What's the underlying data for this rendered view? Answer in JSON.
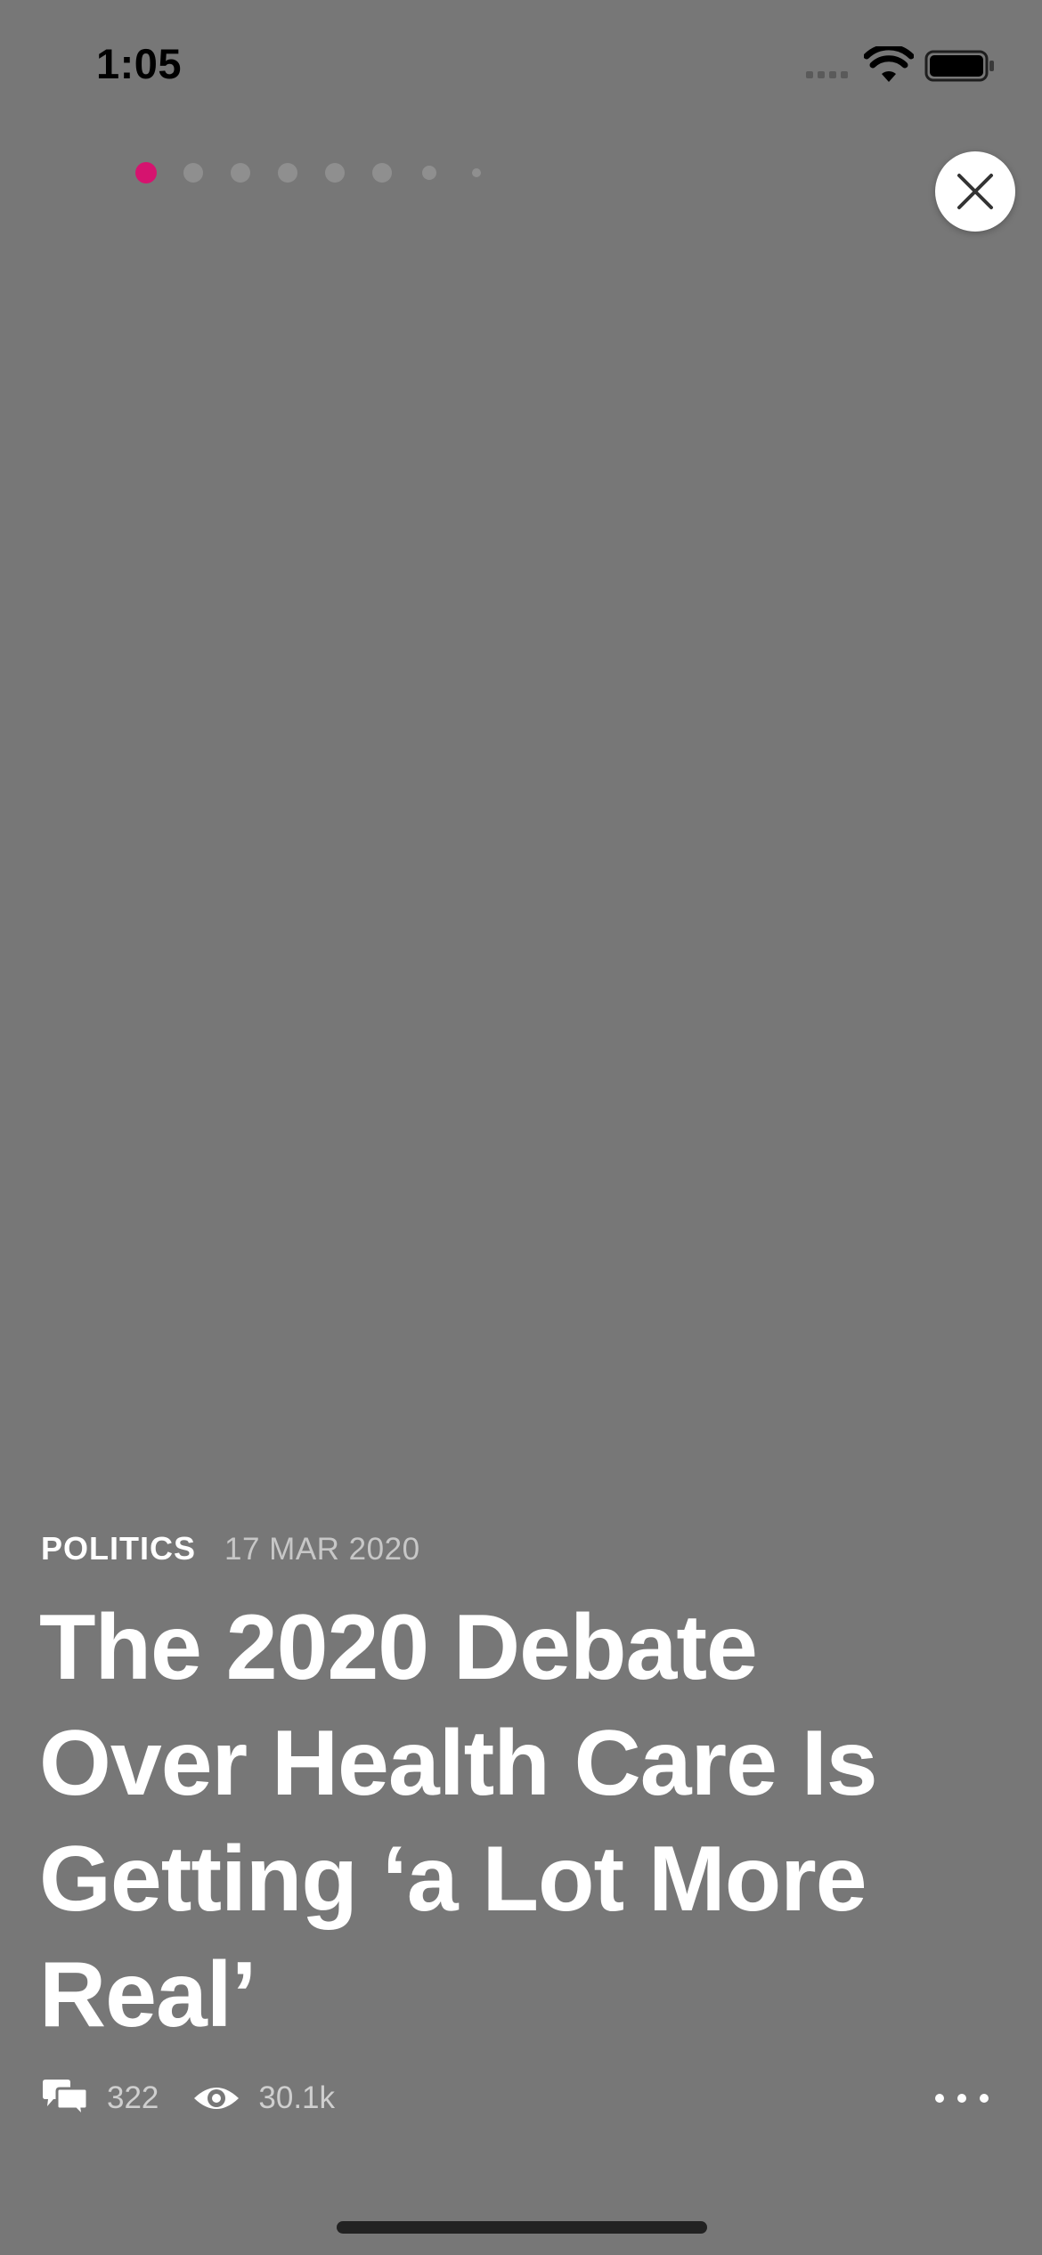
{
  "status_bar": {
    "time": "1:05",
    "icons": [
      "cellular-signal-icon",
      "wifi-icon",
      "battery-icon"
    ]
  },
  "story_progress": {
    "total_pages": 8,
    "current_page": 1,
    "active_color": "#d6136f",
    "inactive_color": "#8f8f8f"
  },
  "close_button": {
    "icon": "close-icon"
  },
  "article": {
    "category": "POLITICS",
    "date": "17 MAR 2020",
    "headline": "The 2020 Debate Over Health Care Is Getting ‘a Lot More Real’"
  },
  "stats": {
    "comments": {
      "icon": "comments-icon",
      "value": "322"
    },
    "views": {
      "icon": "eye-icon",
      "value": "30.1k"
    }
  },
  "more_button": {
    "icon": "more-dots-icon"
  },
  "colors": {
    "background": "#777777",
    "text_primary": "#ffffff",
    "text_secondary": "#c7c7c7"
  }
}
